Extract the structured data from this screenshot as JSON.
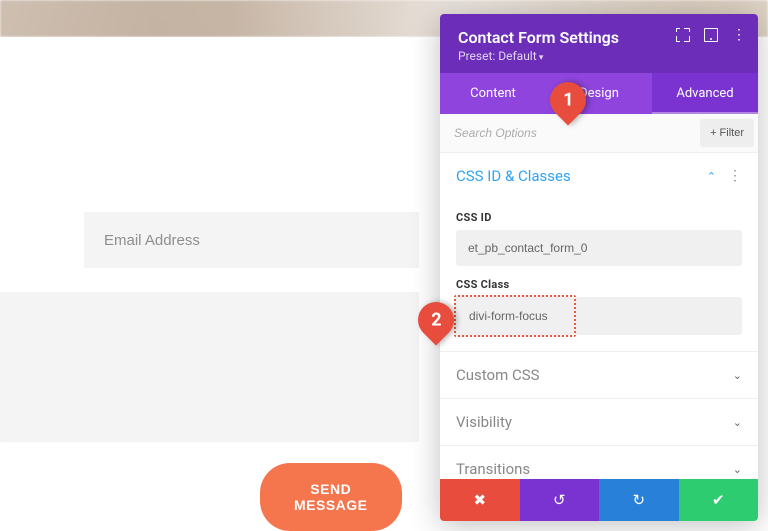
{
  "page": {
    "email_placeholder": "Email Address",
    "send_label": "SEND MESSAGE"
  },
  "panel": {
    "title": "Contact Form Settings",
    "preset": "Preset: Default",
    "tabs": {
      "content": "Content",
      "design": "Design",
      "advanced": "Advanced"
    },
    "search_placeholder": "Search Options",
    "filter_label": "+ Filter",
    "sections": {
      "css_id_classes": {
        "title": "CSS ID & Classes",
        "css_id_label": "CSS ID",
        "css_id_value": "et_pb_contact_form_0",
        "css_class_label": "CSS Class",
        "css_class_value": "divi-form-focus"
      },
      "custom_css": "Custom CSS",
      "visibility": "Visibility",
      "transitions": "Transitions"
    }
  },
  "callouts": {
    "one": "1",
    "two": "2"
  }
}
